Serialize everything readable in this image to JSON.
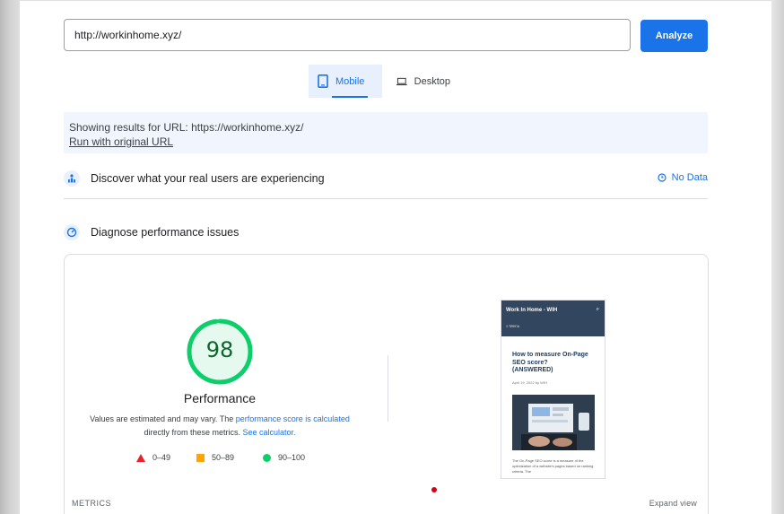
{
  "search": {
    "url_value": "http://workinhome.xyz/",
    "analyze_label": "Analyze"
  },
  "tabs": [
    {
      "label": "Mobile",
      "icon": "smartphone-icon",
      "active": true
    },
    {
      "label": "Desktop",
      "icon": "laptop-icon",
      "active": false
    }
  ],
  "info": {
    "showing_prefix": "Showing results for URL: ",
    "showing_url": "https://workinhome.xyz/",
    "run_original": "Run with original URL"
  },
  "sections": {
    "real_users": {
      "label": "Discover what your real users are experiencing",
      "status": "No Data",
      "icon": "users-icon"
    },
    "diagnose": {
      "label": "Diagnose performance issues",
      "icon": "gauge-icon"
    }
  },
  "performance": {
    "score": "98",
    "score_fraction": 0.98,
    "title": "Performance",
    "desc_part1": "Values are estimated and may vary. The ",
    "desc_link1": "performance score is calculated",
    "desc_part2": "directly from these metrics. ",
    "desc_link2": "See calculator.",
    "legend": [
      {
        "range": "0–49",
        "shape": "triangle",
        "color": "#e8242b"
      },
      {
        "range": "50–89",
        "shape": "square",
        "color": "#ffa400"
      },
      {
        "range": "90–100",
        "shape": "circle",
        "color": "#0cce6b"
      }
    ],
    "colors": {
      "good": "#0cce6b",
      "good_text": "#0d652d",
      "good_bg": "#e6f9ee"
    }
  },
  "preview": {
    "site_name": "Work In Home - WIH",
    "menu_label": "≡  Menu",
    "article_title": "How to measure On-Page SEO score? (ANSWERED)",
    "article_meta": "April 19, 2022 by WIH",
    "article_excerpt": "The On-Page SEO score is a measure of the optimization of a website's pages based on ranking criteria. The"
  },
  "footer": {
    "metrics_label": "METRICS",
    "expand_label": "Expand view"
  },
  "theme": {
    "accent": "#1a73e8",
    "info_bg": "#f1f6fe"
  }
}
